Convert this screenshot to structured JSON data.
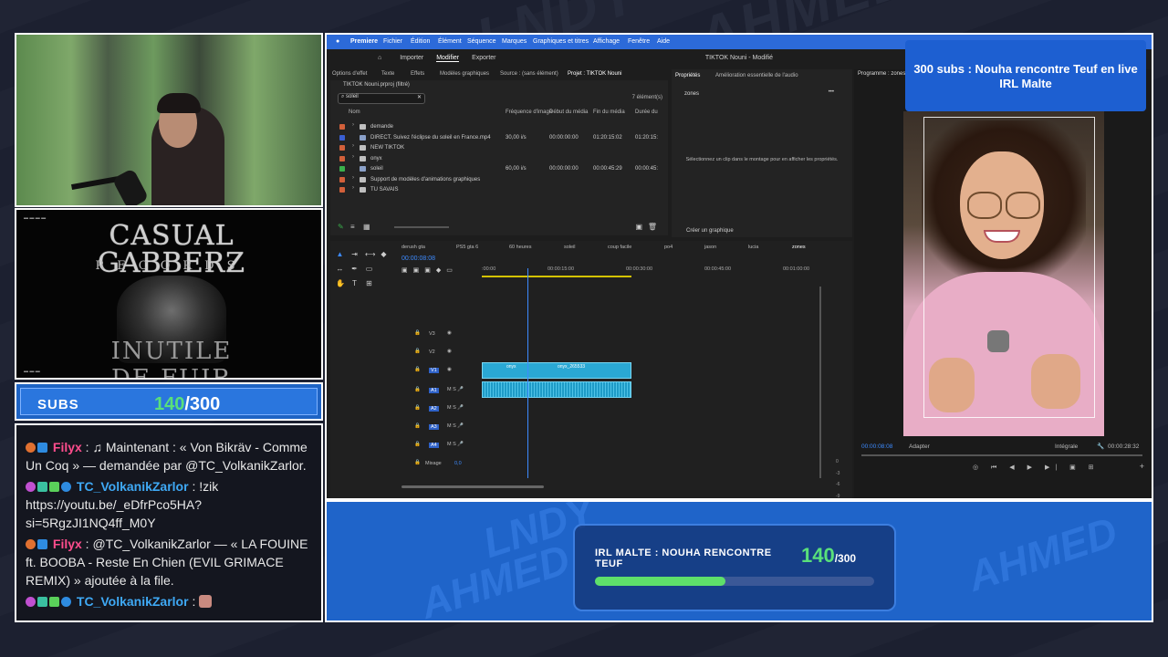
{
  "subs": {
    "label": "SUBS",
    "current": "140",
    "total": "/300"
  },
  "album": {
    "title": "CASUAL GABBERZ",
    "subtitle": "RECORDS",
    "bottom": "INUTILE DE FUIR"
  },
  "chat": [
    {
      "user": "Filyx",
      "user_color": "#ff4d8d",
      "sep": " : ",
      "text": "♫ Maintenant : « Von Bikräv - Comme Un Coq » — demandée par @TC_VolkanikZarlor."
    },
    {
      "user": "TC_VolkanikZarlor",
      "user_color": "#3fa9f5",
      "sep": " : ",
      "text": "!zik https://youtu.be/_eDfrPco5HA?si=5RgzJI1NQ4ff_M0Y"
    },
    {
      "user": "Filyx",
      "user_color": "#ff4d8d",
      "sep": " : ",
      "text": "@TC_VolkanikZarlor — « LA FOUINE ft. BOOBA - Reste En Chien (EVIL GRIMACE REMIX) » ajoutée à la file."
    },
    {
      "user": "TC_VolkanikZarlor",
      "user_color": "#3fa9f5",
      "sep": " : ",
      "text": ""
    }
  ],
  "editor": {
    "menu": [
      "Premiere",
      "Fichier",
      "Édition",
      "Élément",
      "Séquence",
      "Marques",
      "Graphiques et titres",
      "Affichage",
      "Fenêtre",
      "Aide"
    ],
    "title": "TIKTOK Nouni - Modifié",
    "nav": [
      "Importer",
      "Modifier",
      "Exporter"
    ],
    "panel_tabs": [
      "Options d'effet",
      "Texte",
      "Effets",
      "Modèles graphiques",
      "Source : (sans élément)",
      "Projet : TIKTOK Nouni"
    ],
    "project_path": "TIKTOK Nouni.prproj (filtré)",
    "search_value": "soleil",
    "items_count": "7 élément(s)",
    "columns": [
      "Nom",
      "Fréquence d'image",
      "Début du média",
      "Fin du média",
      "Durée du"
    ],
    "rows": [
      {
        "name": "demande",
        "fps": "",
        "start": "",
        "end": "",
        "dur": "",
        "color": "#d2603a",
        "folder": true
      },
      {
        "name": "DIRECT. Suivez l'éclipse du soleil en France.mp4",
        "fps": "30,00 i/s",
        "start": "00:00:00:00",
        "end": "01:20:15:02",
        "dur": "01:20:15:",
        "color": "#3a5fd2",
        "folder": false
      },
      {
        "name": "NEW TIKTOK",
        "fps": "",
        "start": "",
        "end": "",
        "dur": "",
        "color": "#d2603a",
        "folder": true
      },
      {
        "name": "onyx",
        "fps": "",
        "start": "",
        "end": "",
        "dur": "",
        "color": "#d2603a",
        "folder": true
      },
      {
        "name": "soleil",
        "fps": "60,00 i/s",
        "start": "00:00:00:00",
        "end": "00:00:45:29",
        "dur": "00:00:45:",
        "color": "#3ab04c",
        "folder": false
      },
      {
        "name": "Support de modèles d'animations graphiques",
        "fps": "",
        "start": "",
        "end": "",
        "dur": "",
        "color": "#d2603a",
        "folder": true
      },
      {
        "name": "TU SAVAIS",
        "fps": "",
        "start": "",
        "end": "",
        "dur": "",
        "color": "#d2603a",
        "folder": true
      }
    ],
    "props_tabs": [
      "Propriétés",
      "Amélioration essentielle de l'audio"
    ],
    "props_item": "zones",
    "props_msg": "Sélectionnez un clip dans le montage pour en afficher les propriétés.",
    "props_create": "Créer un graphique",
    "seq_tabs": [
      "derush gta",
      "PS5 gta 6",
      "60 heures",
      "soleil",
      "coup facile",
      "po4",
      "jason",
      "lucia",
      "zones"
    ],
    "timecode": "00:00:08:08",
    "ruler": [
      ":00:00",
      "00:00:15:00",
      "00:00:30:00",
      "00:00:45:00",
      "00:01:00:00"
    ],
    "tracks": [
      "V3",
      "V2",
      "V1",
      "A1",
      "A2",
      "A3",
      "A4"
    ],
    "mix_label": "Mixage",
    "mix_value": "0,0",
    "clip_labels": [
      "onyx",
      "onyx_265533"
    ],
    "program_title": "Programme : zones",
    "monitor_time": "00:00:08:08",
    "fit": "Adapter",
    "quality": "Intégrale",
    "duration": "00:00:28:32"
  },
  "banner": {
    "text": "300 subs : Nouha rencontre Teuf en live IRL Malte"
  },
  "goal": {
    "title": "IRL MALTE : NOUHA RENCONTRE TEUF",
    "current": "140",
    "total": "/300",
    "progress": 0.467
  },
  "background_words": [
    "LNDY",
    "AHMED"
  ]
}
